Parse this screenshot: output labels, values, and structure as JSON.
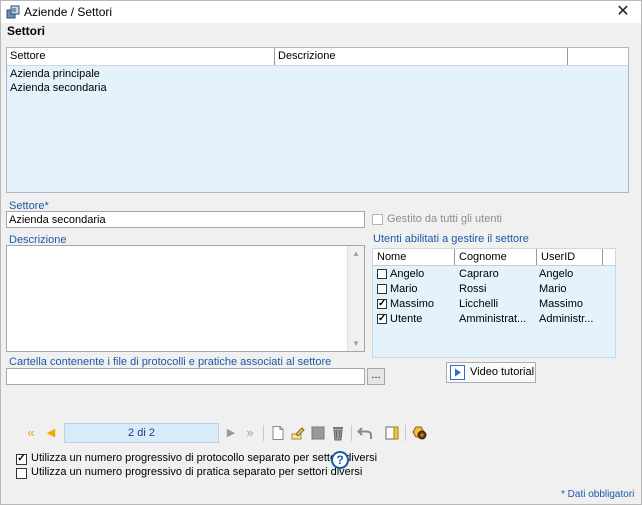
{
  "window": {
    "title": "Aziende / Settori",
    "close_glyph": "✕"
  },
  "section_title": "Settori",
  "sectors_grid": {
    "columns": [
      "Settore",
      "Descrizione"
    ],
    "rows": [
      {
        "settore": "Azienda principale",
        "descrizione": ""
      },
      {
        "settore": "Azienda secondaria",
        "descrizione": ""
      }
    ]
  },
  "form": {
    "settore_label": "Settore*",
    "settore_value": "Azienda secondaria",
    "gestito_label": "Gestito da tutti gli utenti",
    "gestito_checked": false,
    "descrizione_label": "Descrizione",
    "descrizione_value": "",
    "utenti_label": "Utenti abilitati a gestire il settore",
    "cartella_label": "Cartella contenente i file di protocolli e pratiche associati al settore",
    "cartella_value": "",
    "browse_label": "...",
    "video_label": "Video tutorial"
  },
  "users_table": {
    "columns": [
      "Nome",
      "Cognome",
      "UserID"
    ],
    "rows": [
      {
        "checked": false,
        "nome": "Angelo",
        "cognome": "Capraro",
        "userid": "Angelo"
      },
      {
        "checked": false,
        "nome": "Mario",
        "cognome": "Rossi",
        "userid": "Mario"
      },
      {
        "checked": true,
        "nome": "Massimo",
        "cognome": "Licchelli",
        "userid": "Massimo"
      },
      {
        "checked": true,
        "nome": "Utente",
        "cognome": "Amministrat...",
        "userid": "Administr..."
      }
    ]
  },
  "toolbar": {
    "pager_text": "2 di 2",
    "icons": [
      "first-icon",
      "prev-icon",
      "next-icon",
      "last-icon",
      "new-icon",
      "edit-icon",
      "save-icon",
      "delete-icon",
      "undo-icon",
      "notes-icon",
      "search-icon"
    ]
  },
  "options": {
    "protocollo_label": "Utilizza un numero progressivo di protocollo separato per settori diversi",
    "protocollo_checked": true,
    "pratica_label": "Utilizza un numero progressivo di pratica separato per settori diversi",
    "pratica_checked": false,
    "help_glyph": "?"
  },
  "footer_note": "* Dati obbligatori",
  "colors": {
    "label_blue": "#1a5aa8",
    "grid_bg": "#e4f3fb",
    "pager_bg": "#d8ebf9",
    "arrow_gold": "#f0a800"
  }
}
